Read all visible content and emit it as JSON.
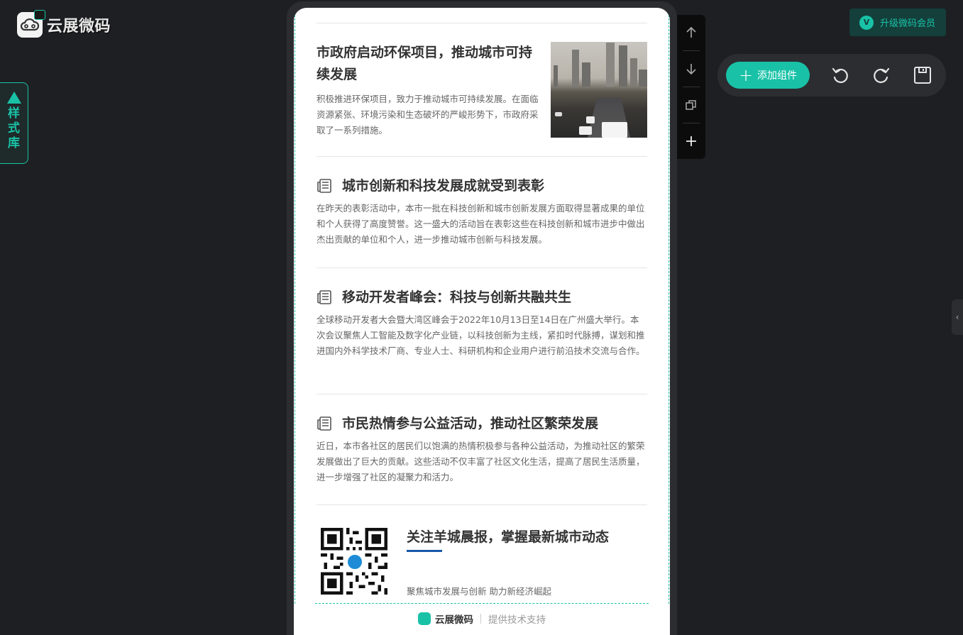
{
  "brand": {
    "name": "云展微码"
  },
  "style_library": {
    "label": "样式库"
  },
  "upgrade": {
    "label": "升级微码会员",
    "badge": "V"
  },
  "toolbar": {
    "add_label": "添加组件"
  },
  "articles": [
    {
      "title": "市政府启动环保项目，推动城市可持续发展",
      "body": "积极推进环保项目，致力于推动城市可持续发展。在面临资源紧张、环境污染和生态破坏的严峻形势下，市政府采取了一系列措施。"
    },
    {
      "title": "城市创新和科技发展成就受到表彰",
      "body": "在昨天的表彰活动中，本市一批在科技创新和城市创新发展方面取得显著成果的单位和个人获得了高度赞誉。这一盛大的活动旨在表彰这些在科技创新和城市进步中做出杰出贡献的单位和个人，进一步推动城市创新与科技发展。"
    },
    {
      "title": "移动开发者峰会：科技与创新共融共生",
      "body": "全球移动开发者大会暨大湾区峰会于2022年10月13日至14日在广州盛大举行。本次会议聚焦人工智能及数字化产业链，以科技创新为主线，紧扣时代脉搏，谋划和推进国内外科学技术厂商、专业人士、科研机构和企业用户进行前沿技术交流与合作。"
    },
    {
      "title": "市民热情参与公益活动，推动社区繁荣发展",
      "body": "近日，本市各社区的居民们以饱满的热情积极参与各种公益活动，为推动社区的繁荣发展做出了巨大的贡献。这些活动不仅丰富了社区文化生活，提高了居民生活质量，进一步增强了社区的凝聚力和活力。"
    }
  ],
  "follow": {
    "title": "关注羊城晨报，掌握最新城市动态",
    "subtitle": "聚焦城市发展与创新 助力新经济崛起"
  },
  "footer": {
    "brand": "云展微码",
    "support": "提供技术支持"
  },
  "colors": {
    "accent": "#19c2a7",
    "background": "#1e1f22",
    "blue_bar": "#1757a8"
  }
}
